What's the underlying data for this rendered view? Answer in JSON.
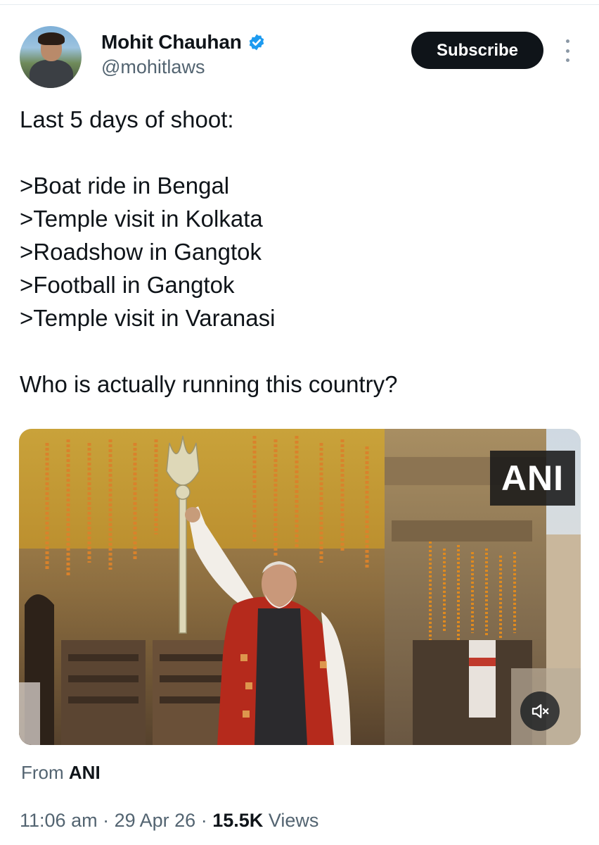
{
  "author": {
    "name": "Mohit Chauhan",
    "handle": "@mohitlaws",
    "verified": true
  },
  "subscribe_label": "Subscribe",
  "tweet": {
    "lines": [
      "Last 5 days of shoot:",
      "",
      ">Boat ride in Bengal",
      ">Temple visit in Kolkata",
      ">Roadshow in Gangtok",
      ">Football in Gangtok",
      ">Temple visit in Varanasi",
      "",
      "Who is actually running this country?"
    ]
  },
  "media": {
    "watermark": "ANI",
    "muted": true
  },
  "source": {
    "prefix": "From",
    "name": "ANI"
  },
  "meta": {
    "time": "11:06 am",
    "sep1": "·",
    "date": "29 Apr 26",
    "sep2": "·",
    "views_count": "15.5K",
    "views_label": "Views"
  },
  "colors": {
    "verified_badge": "#1d9bf0",
    "button_bg": "#0f1419",
    "secondary_text": "#536471"
  },
  "icons": [
    "verified-badge-icon",
    "more-options-icon",
    "mute-icon"
  ]
}
